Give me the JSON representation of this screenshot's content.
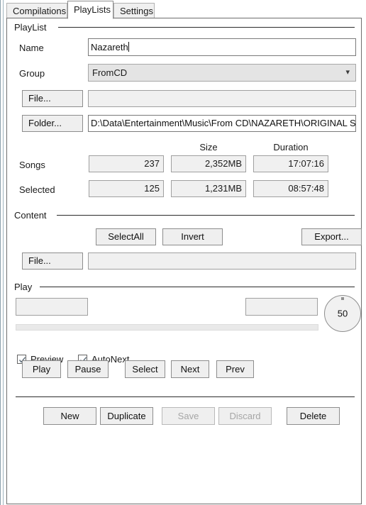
{
  "window": {
    "tabs": [
      {
        "label": "Compilations",
        "active": false
      },
      {
        "label": "PlayLists",
        "active": true
      },
      {
        "label": "Settings",
        "active": false
      }
    ]
  },
  "playlist_group": {
    "title": "PlayList",
    "name_label": "Name",
    "name_value": "Nazareth",
    "group_label": "Group",
    "group_value": "FromCD",
    "group_chevron": "chevron-down-icon",
    "file_button": "File...",
    "file_value": "",
    "folder_button": "Folder...",
    "folder_value": "D:\\Data\\Entertainment\\Music\\From CD\\NAZARETH\\ORIGINAL STUDIO",
    "col_size": "Size",
    "col_duration": "Duration",
    "rows": [
      {
        "label": "Songs",
        "count": "237",
        "size": "2,352MB",
        "duration": "17:07:16"
      },
      {
        "label": "Selected",
        "count": "125",
        "size": "1,231MB",
        "duration": "08:57:48"
      }
    ]
  },
  "content_group": {
    "title": "Content",
    "select_all_button": "SelectAll",
    "invert_button": "Invert",
    "export_button": "Export...",
    "file_button": "File...",
    "file_value": ""
  },
  "play_group": {
    "title": "Play",
    "left_field_value": "",
    "right_field_value": "",
    "progress_percent": 0,
    "volume_knob_value": "50",
    "checkboxes": [
      {
        "label": "Preview",
        "checked": true
      },
      {
        "label": "AutoNext",
        "checked": true
      }
    ],
    "transport_buttons": [
      {
        "label": "Play",
        "disabled": false
      },
      {
        "label": "Pause",
        "disabled": false
      },
      {
        "label": "Select",
        "disabled": false
      },
      {
        "label": "Next",
        "disabled": false
      },
      {
        "label": "Prev",
        "disabled": false
      }
    ]
  },
  "record_actions": [
    {
      "label": "New",
      "disabled": false
    },
    {
      "label": "Duplicate",
      "disabled": false
    },
    {
      "label": "Save",
      "disabled": true
    },
    {
      "label": "Discard",
      "disabled": true
    },
    {
      "label": "Delete",
      "disabled": false
    }
  ],
  "colors": {
    "window_bg": "#ffffff",
    "panel_border": "#6e6e6e",
    "button_face": "#efefef",
    "readonly_field": "#f0f0f0",
    "combo_face": "#e4e4e4",
    "disabled_text": "#a6a6a6",
    "check_mark": "#5c6b78"
  }
}
